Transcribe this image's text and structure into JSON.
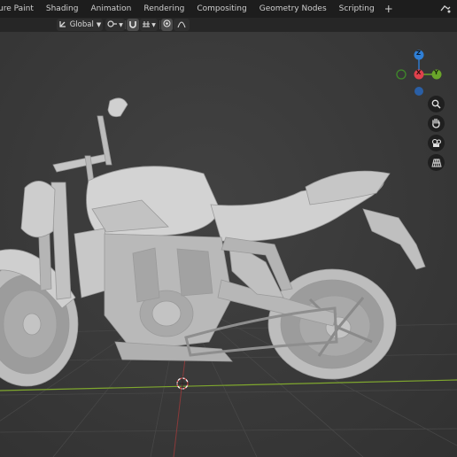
{
  "workspace_tabs": [
    "ure Paint",
    "Shading",
    "Animation",
    "Rendering",
    "Compositing",
    "Geometry Nodes",
    "Scripting"
  ],
  "add_workspace_label": "+",
  "header": {
    "transform_orientation": "Global"
  },
  "gizmo": {
    "z_label": "Z",
    "x_label": "X",
    "y_label": "Y",
    "z_color": "#2f7fd6",
    "x_color": "#e0414c",
    "y_color": "#6aa52a",
    "neg_z_color": "#2a5fa5",
    "neg_y_color": "#3f6e1f"
  },
  "icons": {
    "zoom": "magnifier-icon",
    "pan": "hand-icon",
    "camera": "camera-icon",
    "projection": "grid-perspective-icon"
  },
  "colors": {
    "tabbar_bg": "#1d1d1d",
    "header_bg": "#262626",
    "viewport_bg": "#3a3a3a",
    "grid_line": "#454545",
    "x_axis_line": "#7fa72e",
    "model": "#c8c8c8"
  }
}
